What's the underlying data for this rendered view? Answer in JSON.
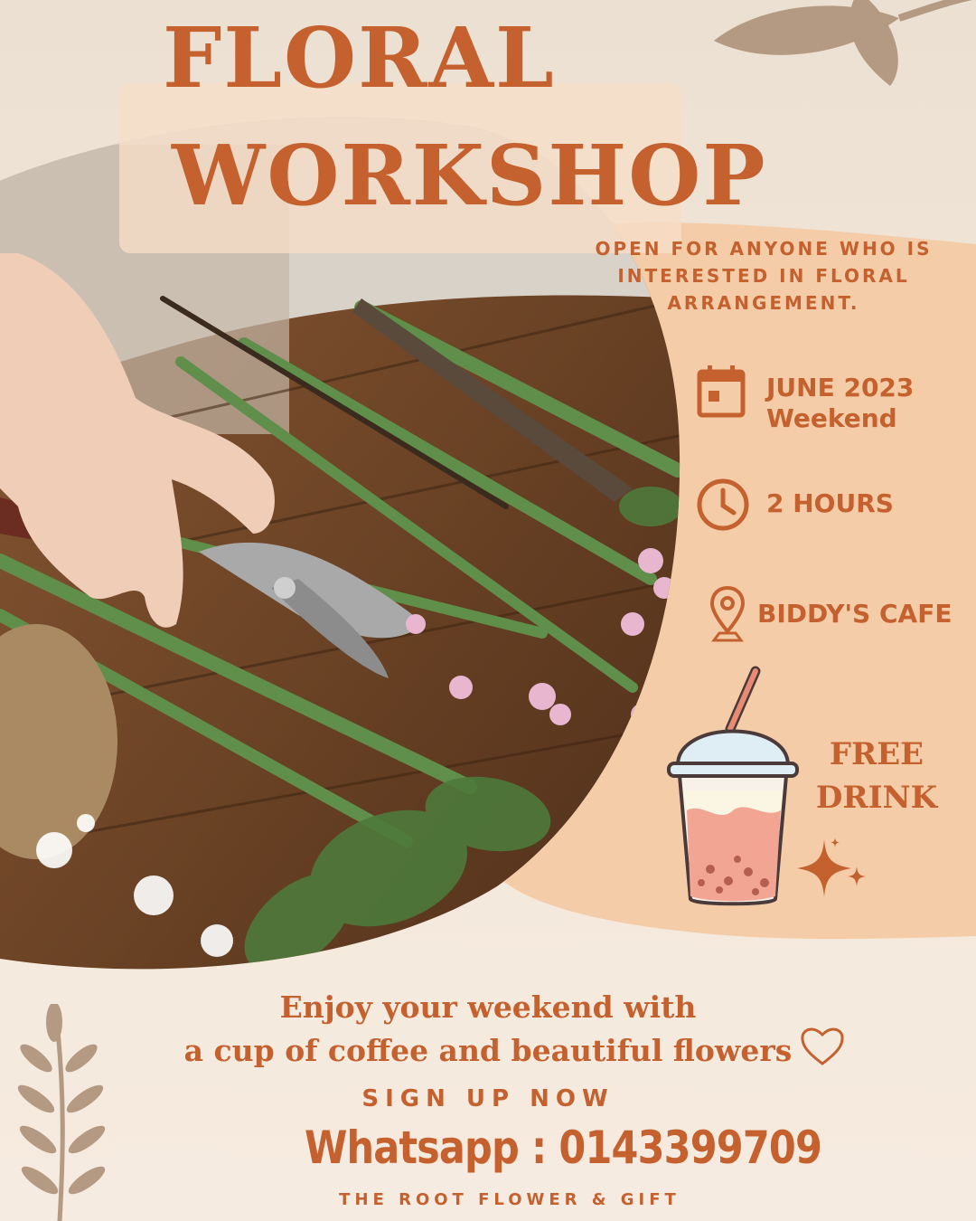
{
  "poster": {
    "title_line1": "FLORAL",
    "title_line2": "WORKSHOP",
    "intro": "OPEN FOR ANYONE WHO IS INTERESTED IN FLORAL ARRANGEMENT.",
    "date_line1": "JUNE 2023",
    "date_line2": "Weekend",
    "duration": "2 HOURS",
    "location": "BIDDY'S CAFE",
    "drink_line1": "FREE",
    "drink_line2": "DRINK",
    "tagline_line1": "Enjoy your weekend with",
    "tagline_line2": "a cup of coffee and beautiful flowers",
    "cta": "SIGN UP NOW",
    "contact": "Whatsapp : 0143399709",
    "brand": "THE ROOT FLOWER & GIFT"
  },
  "icons": [
    "calendar-icon",
    "clock-icon",
    "location-pin-icon",
    "bubble-tea-icon",
    "sparkle-icon",
    "heart-icon",
    "leaf-branch-icon"
  ],
  "colors": {
    "accent": "#c4612e",
    "peach": "#f4cda8",
    "background": "#f1e4d6",
    "leaf": "#b49a82"
  }
}
